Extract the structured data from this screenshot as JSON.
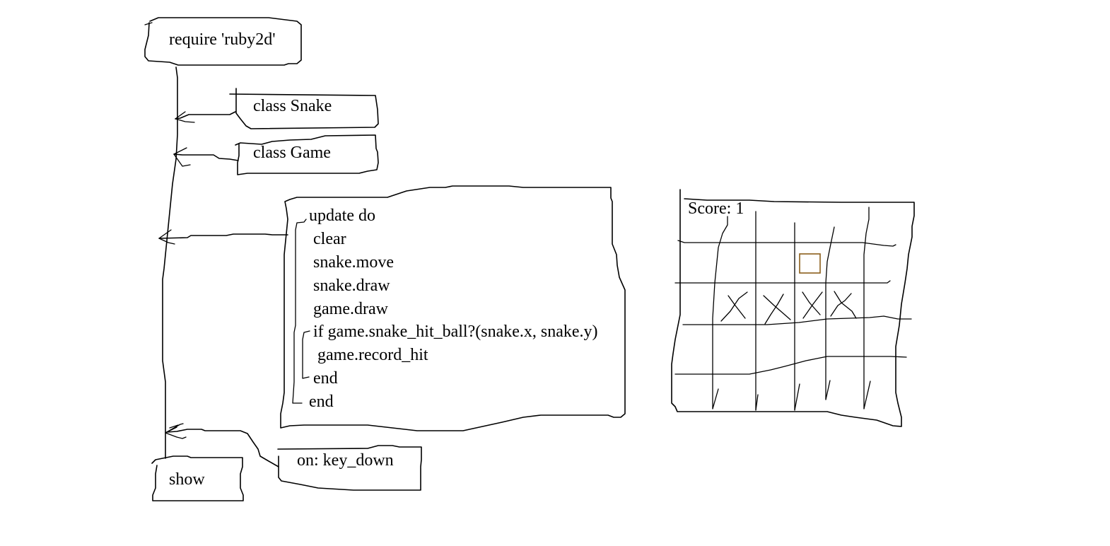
{
  "nodes": {
    "require": "require 'ruby2d'",
    "snake_class": "class Snake",
    "game_class": "class Game",
    "update_block": [
      "update do",
      "clear",
      "snake.move",
      "snake.draw",
      "game.draw",
      "if game.snake_hit_ball?(snake.x, snake.y)",
      "game.record_hit",
      "end",
      "end"
    ],
    "show": "show",
    "key_down": "on: key_down"
  },
  "game_sketch": {
    "score_label": "Score: 1",
    "ball_color": "#8B5E1A"
  }
}
